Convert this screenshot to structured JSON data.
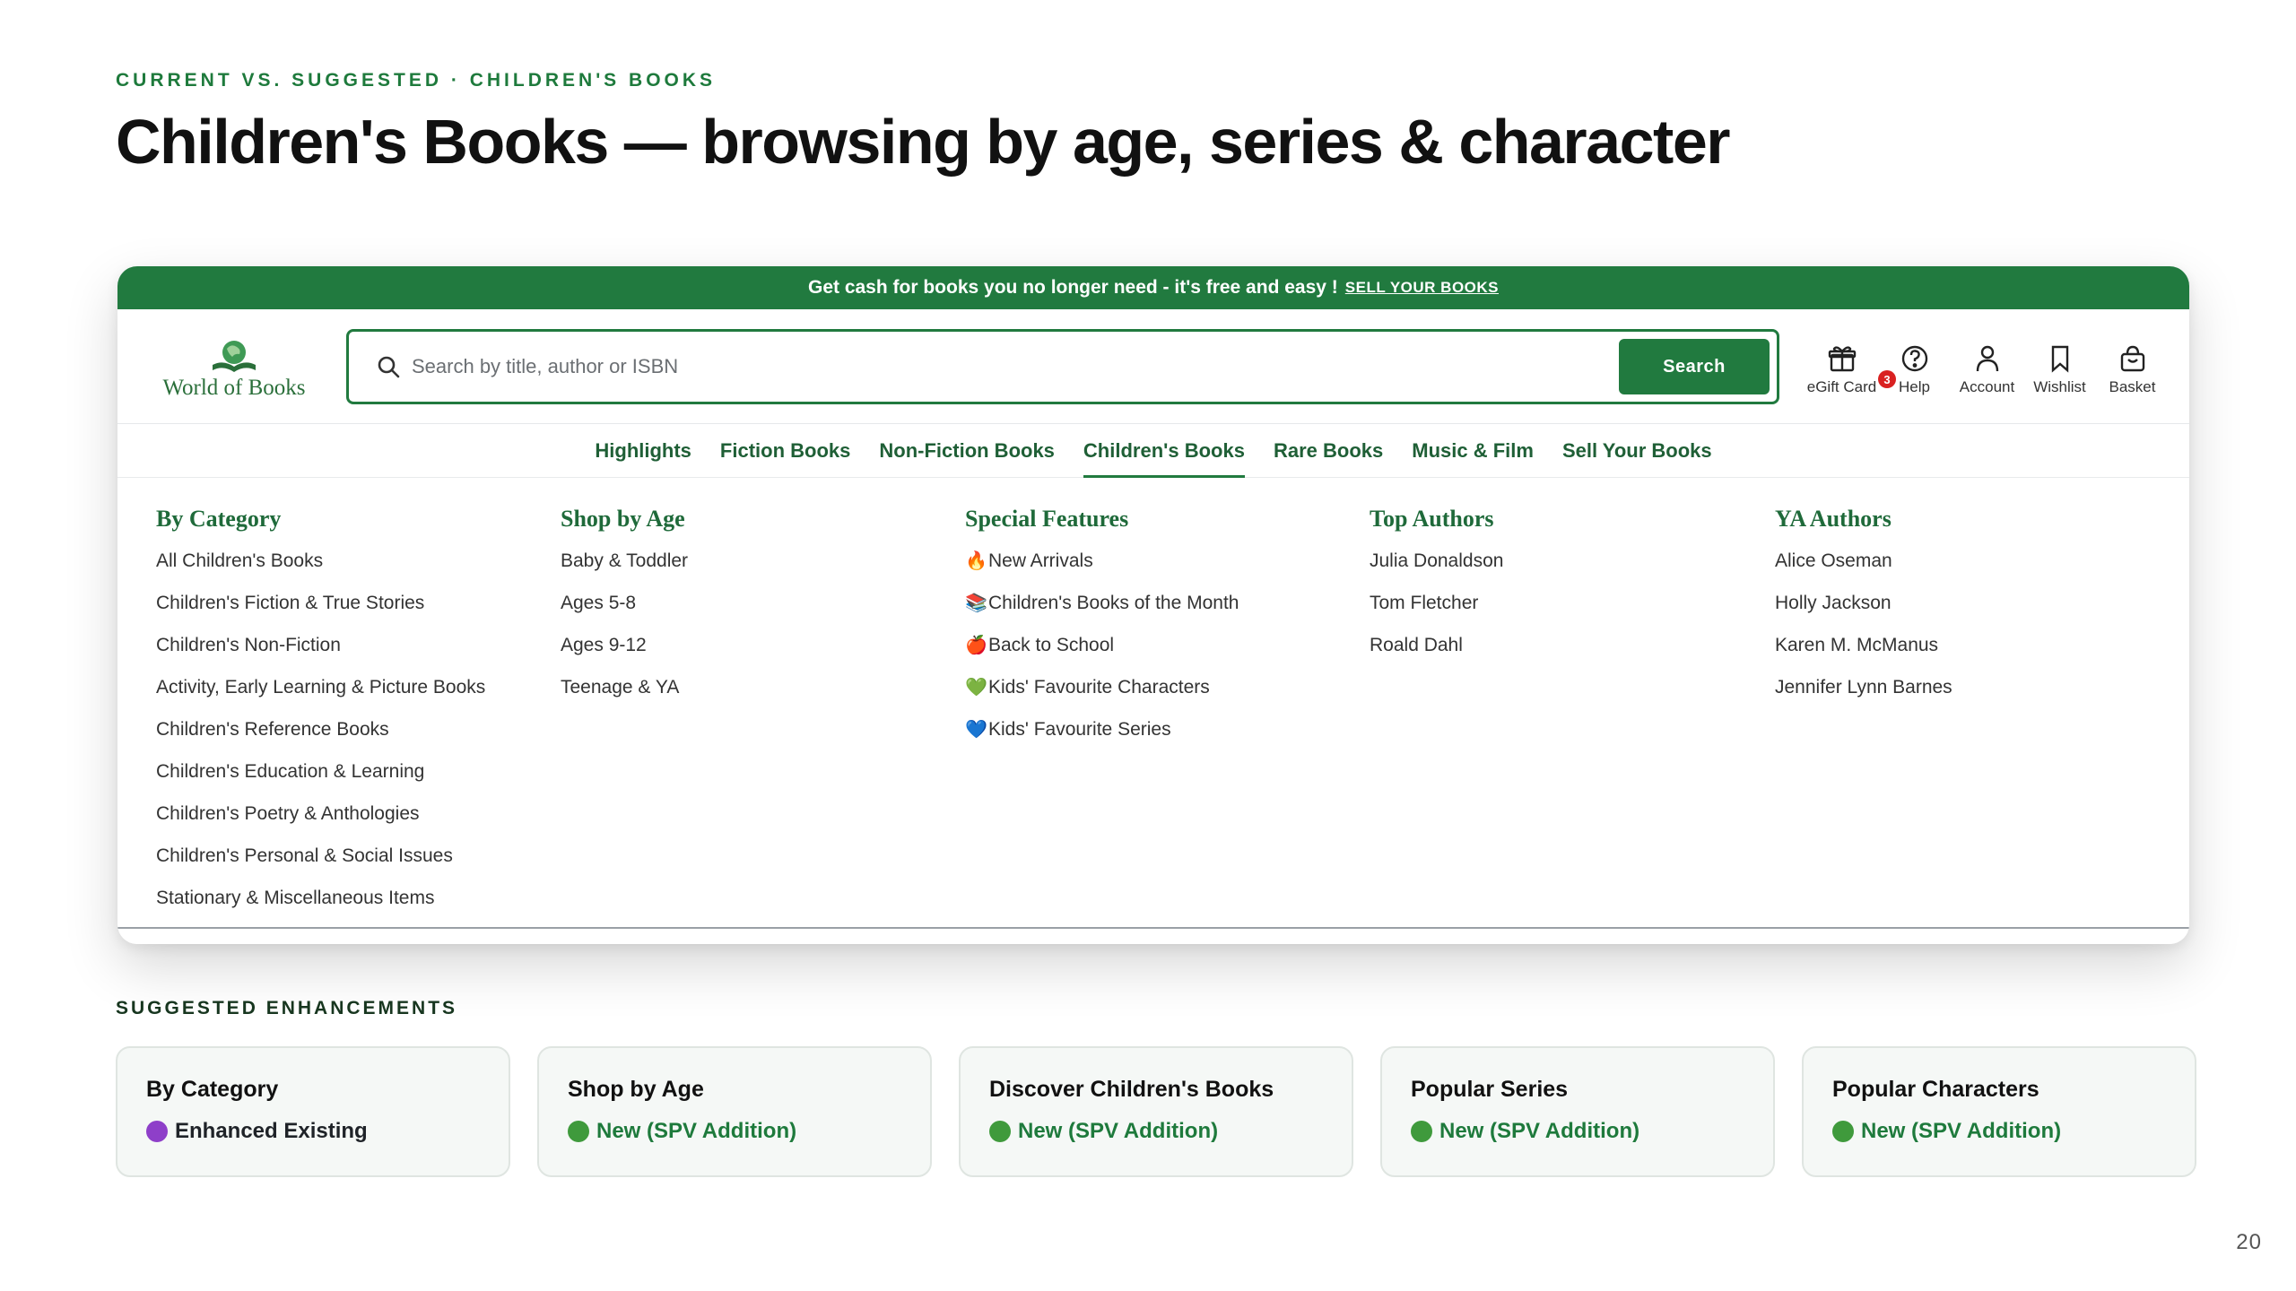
{
  "slide": {
    "eyebrow": "CURRENT VS. SUGGESTED · CHILDREN'S BOOKS",
    "title": "Children's Books — browsing by age, series & character",
    "page_number": "20"
  },
  "site": {
    "promo_text": "Get cash for books you no longer need - it's free and easy !",
    "promo_link": "SELL YOUR BOOKS",
    "logo_text": "World of Books",
    "search_placeholder": "Search by title, author or ISBN",
    "search_button": "Search",
    "header_icons": [
      {
        "label": "eGift Card",
        "icon": "gift-icon"
      },
      {
        "label": "Help",
        "icon": "help-icon"
      },
      {
        "label": "Account",
        "icon": "account-icon"
      },
      {
        "label": "Wishlist",
        "icon": "bookmark-icon"
      },
      {
        "label": "Basket",
        "icon": "basket-icon"
      }
    ],
    "basket_count": "3",
    "nav": [
      "Highlights",
      "Fiction Books",
      "Non-Fiction Books",
      "Children's Books",
      "Rare Books",
      "Music & Film",
      "Sell Your Books"
    ],
    "active_nav": "Children's Books",
    "accent_color": "#217a3f"
  },
  "menu": {
    "columns": [
      {
        "heading": "By Category",
        "items": [
          {
            "label": "All Children's Books"
          },
          {
            "label": "Children's Fiction & True Stories"
          },
          {
            "label": "Children's Non-Fiction"
          },
          {
            "label": "Activity, Early Learning & Picture Books"
          },
          {
            "label": "Children's Reference Books"
          },
          {
            "label": "Children's Education & Learning"
          },
          {
            "label": "Children's Poetry & Anthologies"
          },
          {
            "label": "Children's Personal & Social Issues"
          },
          {
            "label": "Stationary & Miscellaneous Items"
          }
        ]
      },
      {
        "heading": "Shop by Age",
        "items": [
          {
            "label": "Baby & Toddler"
          },
          {
            "label": "Ages 5-8"
          },
          {
            "label": "Ages 9-12"
          },
          {
            "label": "Teenage & YA"
          }
        ]
      },
      {
        "heading": "Special Features",
        "items": [
          {
            "emoji": "🔥",
            "label": "New Arrivals"
          },
          {
            "emoji": "📚",
            "label": "Children's Books of the Month"
          },
          {
            "emoji": "🍎",
            "label": "Back to School"
          },
          {
            "emoji": "💚",
            "label": "Kids' Favourite Characters"
          },
          {
            "emoji": "💙",
            "label": "Kids' Favourite Series"
          }
        ]
      },
      {
        "heading": "Top Authors",
        "items": [
          {
            "label": "Julia Donaldson"
          },
          {
            "label": "Tom Fletcher"
          },
          {
            "label": "Roald Dahl"
          }
        ]
      },
      {
        "heading": "YA Authors",
        "items": [
          {
            "label": "Alice Oseman"
          },
          {
            "label": "Holly Jackson"
          },
          {
            "label": "Karen M. McManus"
          },
          {
            "label": "Jennifer Lynn Barnes"
          }
        ]
      }
    ]
  },
  "enhancements": {
    "label": "SUGGESTED ENHANCEMENTS",
    "cards": [
      {
        "title": "By Category",
        "status": "Enhanced Existing",
        "dot_color": "#8e3fc9",
        "text_color": "#1f2328"
      },
      {
        "title": "Shop by Age",
        "status": "New (SPV Addition)",
        "dot_color": "#3f9a3c",
        "text_color": "#1e7a3c"
      },
      {
        "title": "Discover Children's Books",
        "status": "New (SPV Addition)",
        "dot_color": "#3f9a3c",
        "text_color": "#1e7a3c"
      },
      {
        "title": "Popular Series",
        "status": "New (SPV Addition)",
        "dot_color": "#3f9a3c",
        "text_color": "#1e7a3c"
      },
      {
        "title": "Popular Characters",
        "status": "New (SPV Addition)",
        "dot_color": "#3f9a3c",
        "text_color": "#1e7a3c"
      }
    ]
  }
}
